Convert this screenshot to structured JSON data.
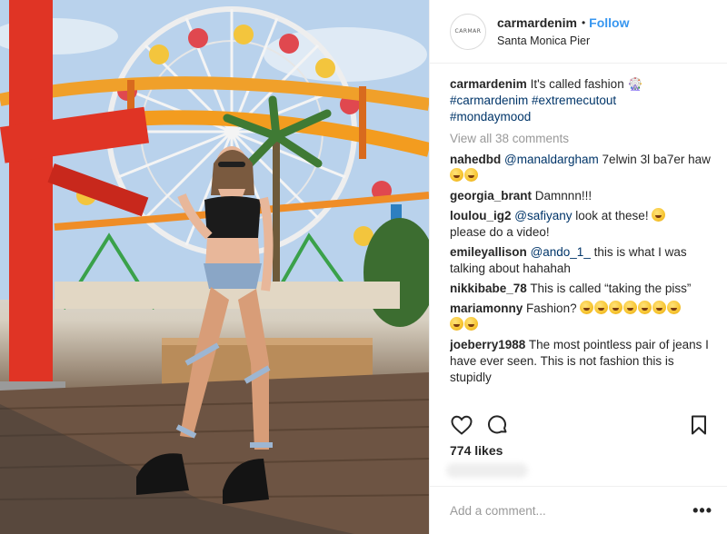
{
  "header": {
    "avatar_text": "CARMAR",
    "username": "carmardenim",
    "separator": "•",
    "follow_label": "Follow",
    "location": "Santa Monica Pier"
  },
  "caption": {
    "username": "carmardenim",
    "text": "It's called fashion",
    "emoji": "ferris-wheel-emoji",
    "hashtags": [
      "#carmardenim",
      "#extremecutout",
      "#mondaymood"
    ]
  },
  "view_all": "View all 38 comments",
  "comments": [
    {
      "user": "nahedbd",
      "mention": "@manaldargham",
      "text": "7elwin 3l ba7er haw",
      "emoji_count": 2
    },
    {
      "user": "georgia_brant",
      "mention": "",
      "text": "Damnnn!!!",
      "emoji_count": 0
    },
    {
      "user": "loulou_ig2",
      "mention": "@safiyany",
      "text": "look at these!",
      "text_after": "please do a video!",
      "emoji_count": 1
    },
    {
      "user": "emileyallison",
      "mention": "@ando_1_",
      "text": "this is what I was talking about hahahah",
      "emoji_count": 0
    },
    {
      "user": "nikkibabe_78",
      "mention": "",
      "text": "This is called “taking the piss”",
      "emoji_count": 0
    },
    {
      "user": "mariamonny",
      "mention": "",
      "text": "Fashion?",
      "emoji_count": 9
    },
    {
      "user": "joeberry1988",
      "mention": "",
      "text": "The most pointless pair of jeans I have ever seen. This is not fashion this is stupidly",
      "emoji_count": 0
    }
  ],
  "actions": {
    "like_icon": "heart-icon",
    "comment_icon": "comment-icon",
    "save_icon": "bookmark-icon"
  },
  "likes": "774 likes",
  "add_comment": {
    "placeholder": "Add a comment...",
    "more_label": "•••"
  },
  "colors": {
    "follow": "#3897f0",
    "hashtag": "#003569",
    "muted": "#999999",
    "text": "#262626"
  }
}
